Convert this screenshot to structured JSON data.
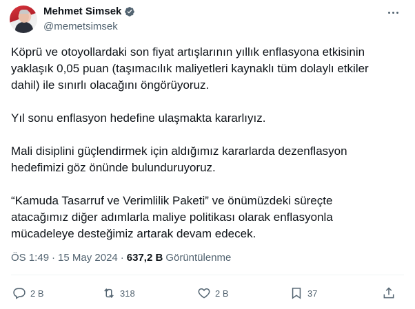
{
  "author": {
    "display_name": "Mehmet Simsek",
    "handle": "@memetsimsek",
    "verified_icon": "verified-badge-icon",
    "verified_color": "#536471"
  },
  "tweet": {
    "paragraphs": [
      "Köprü ve otoyollardaki son fiyat artışlarının yıllık enflasyona etkisinin\nyaklaşık 0,05 puan (taşımacılık maliyetleri kaynaklı tüm dolaylı etkiler\ndahil) ile sınırlı olacağını öngörüyoruz.",
      "Yıl sonu enflasyon hedefine ulaşmakta kararlıyız.",
      "Mali disiplini güçlendirmek için aldığımız kararlarda dezenflasyon\nhedefimizi göz önünde bulunduruyoruz.",
      "“Kamuda Tasarruf ve Verimlilik Paketi” ve önümüzdeki süreçte\natacağımız diğer adımlarla maliye politikası olarak enflasyonla\nmücadeleye desteğimiz artarak devam edecek."
    ],
    "time": "ÖS 1:49",
    "separator": "·",
    "date": "15 May 2024",
    "views_count": "637,2 B",
    "views_label": "Görüntülenme"
  },
  "actions": {
    "reply_count": "2 B",
    "retweet_count": "318",
    "like_count": "2 B",
    "bookmark_count": "37"
  },
  "colors": {
    "text": "#0f1419",
    "secondary": "#536471",
    "divider": "#eff3f4"
  }
}
